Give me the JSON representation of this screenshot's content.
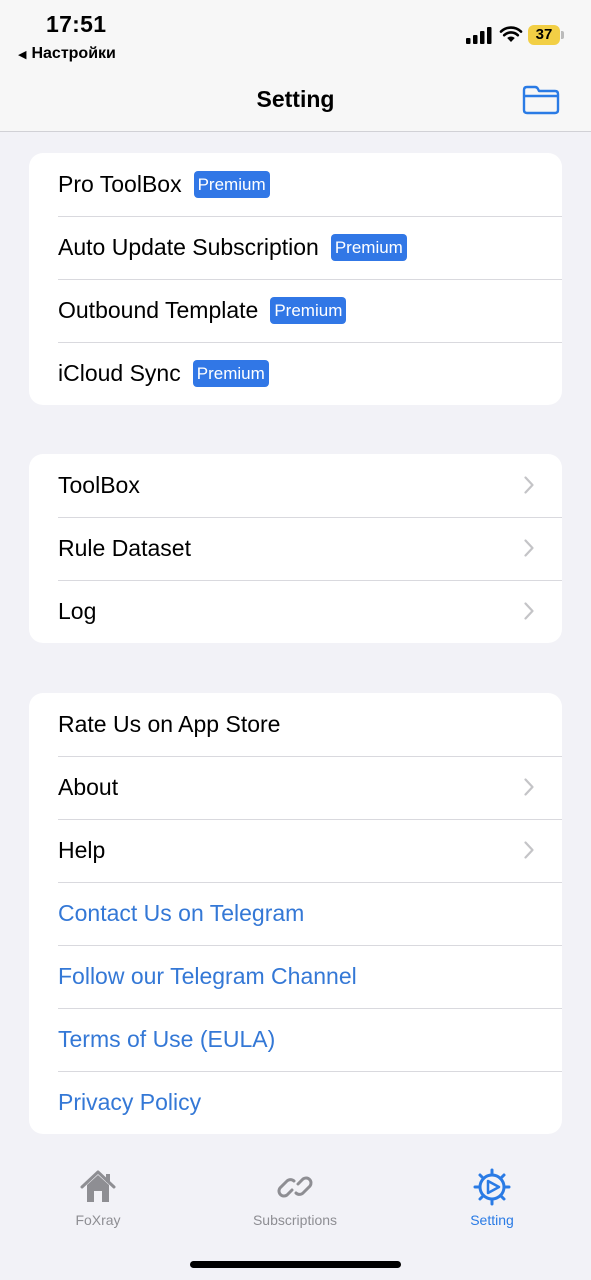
{
  "status_bar": {
    "time": "17:51",
    "back_app": "Настройки",
    "battery_level": "37"
  },
  "nav": {
    "title": "Setting",
    "folder_icon": "folder-icon"
  },
  "groups": {
    "premium": [
      {
        "label": "Pro ToolBox",
        "badge": "Premium"
      },
      {
        "label": "Auto Update Subscription",
        "badge": "Premium"
      },
      {
        "label": "Outbound Template",
        "badge": "Premium"
      },
      {
        "label": "iCloud Sync",
        "badge": "Premium"
      }
    ],
    "tools": [
      {
        "label": "ToolBox"
      },
      {
        "label": "Rule Dataset"
      },
      {
        "label": "Log"
      }
    ],
    "info": [
      {
        "label": "Rate Us on App Store"
      },
      {
        "label": "About"
      },
      {
        "label": "Help"
      },
      {
        "label": "Contact Us on Telegram"
      },
      {
        "label": "Follow our Telegram Channel"
      },
      {
        "label": "Terms of Use (EULA)"
      },
      {
        "label": "Privacy Policy"
      }
    ]
  },
  "tabs": [
    {
      "label": "FoXray",
      "icon": "house-icon"
    },
    {
      "label": "Subscriptions",
      "icon": "link-icon"
    },
    {
      "label": "Setting",
      "icon": "gear-icon",
      "active": true
    }
  ],
  "colors": {
    "accent": "#3478d6",
    "badge": "#3177e6",
    "background": "#f2f2f7"
  }
}
